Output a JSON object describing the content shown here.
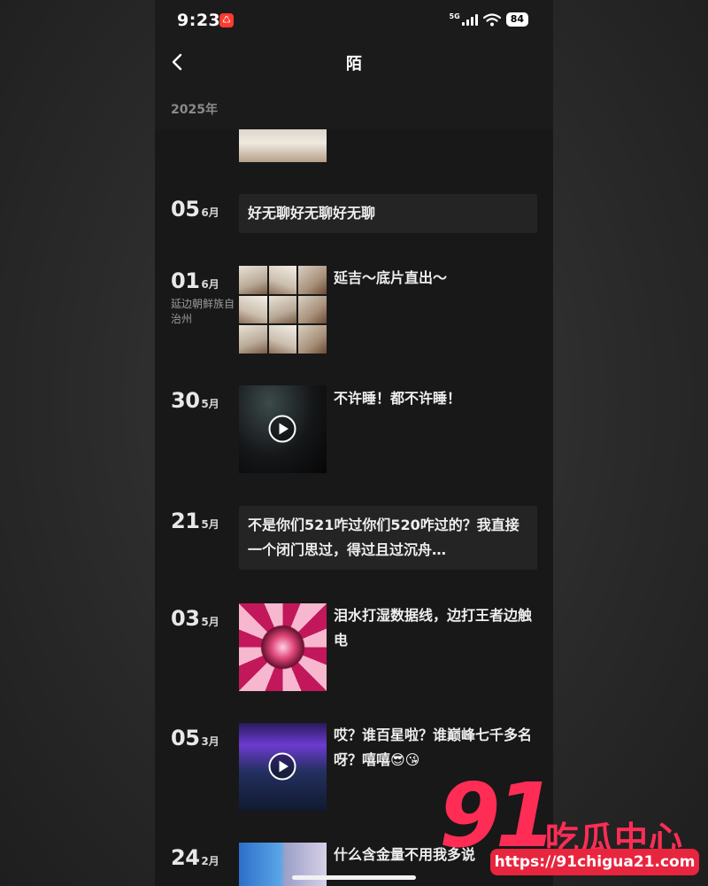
{
  "status_bar": {
    "time": "9:23",
    "app_badge": "♺",
    "network": "5G",
    "battery": "84"
  },
  "header": {
    "back_label": "back",
    "title": "陌"
  },
  "year_label": "2025年",
  "posts": [
    {
      "day": "05",
      "month": "6月",
      "location": "",
      "type": "text",
      "text": "好无聊好无聊好无聊"
    },
    {
      "day": "01",
      "month": "6月",
      "location": "延边朝鲜族自治州",
      "type": "photo-grid",
      "text": "延吉～底片直出～"
    },
    {
      "day": "30",
      "month": "5月",
      "location": "",
      "type": "video",
      "text": "不许睡！都不许睡！"
    },
    {
      "day": "21",
      "month": "5月",
      "location": "",
      "type": "text",
      "text": "不是你们521咋过你们520咋过的？我直接一个闭门思过，得过且过沉舟…"
    },
    {
      "day": "03",
      "month": "5月",
      "location": "",
      "type": "image",
      "text": "泪水打湿数据线，边打王者边触电"
    },
    {
      "day": "05",
      "month": "3月",
      "location": "",
      "type": "video",
      "text": "哎？谁百星啦？谁巅峰七千多名呀？嘻嘻😎😘"
    },
    {
      "day": "24",
      "month": "2月",
      "location": "",
      "type": "image",
      "text": "什么含金量不用我多说"
    }
  ],
  "watermark": {
    "number": "91",
    "text": "吃瓜中心",
    "url": "https://91chigua21.com"
  },
  "colors": {
    "background": "#181818",
    "card": "#242424",
    "watermark_red": "#ff2d55"
  }
}
